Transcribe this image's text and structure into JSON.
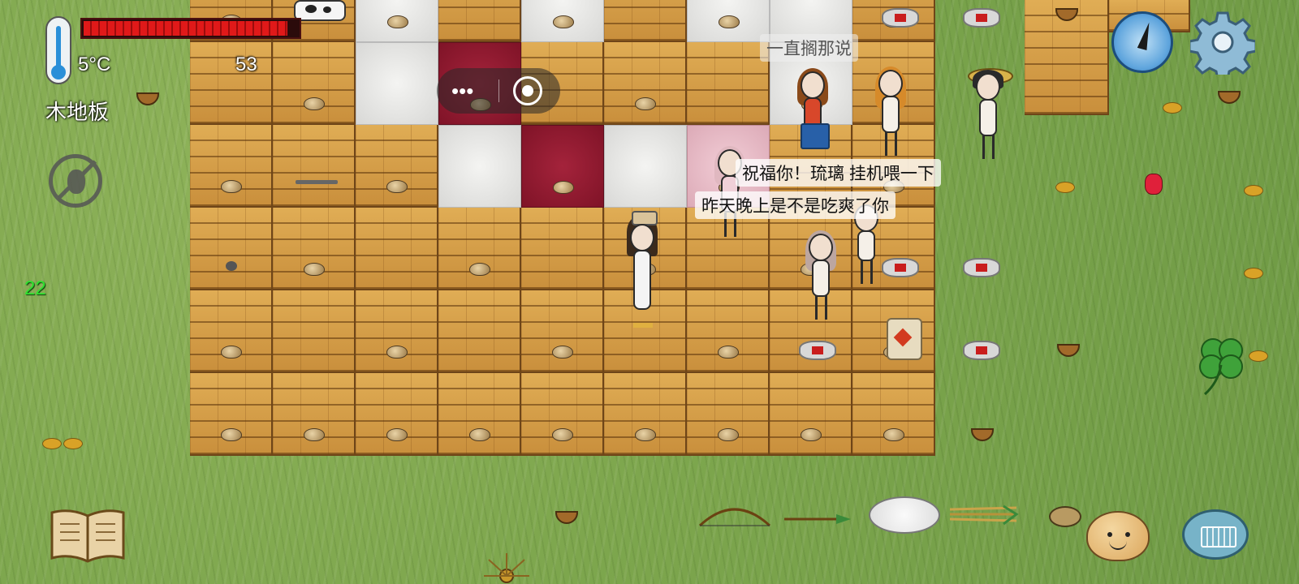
{
  "hud": {
    "temperature": "5°C",
    "tile_name": "木地板",
    "age": "53",
    "counter": "22",
    "food_level": 0.95
  },
  "chat": {
    "line_top": "一直搁那说",
    "line_mid": "祝福你！琉璃 挂机喂一下",
    "line_bottom": "昨天晚上是不是吃爽了你"
  },
  "icons": {
    "thermometer": "thermometer-icon",
    "food_meter": "food-meter-icon",
    "insect_disabled": "no-bug-icon",
    "menu": "more-dots-icon",
    "record": "record-icon",
    "compass": "compass-icon",
    "settings": "gear-icon",
    "journal": "book-icon",
    "emote": "smiley-face-icon",
    "keyboard": "keyboard-icon"
  },
  "colors": {
    "food_bar": "#e01919",
    "counter": "#2fe02f",
    "wood": "#d7a04a",
    "rug_red": "#8f1a30",
    "rug_white": "#e8e8e6",
    "rug_pink": "#e8bcc7"
  }
}
